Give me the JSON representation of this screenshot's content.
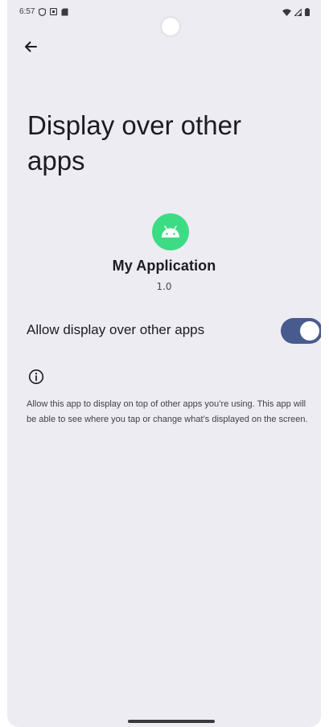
{
  "status_bar": {
    "time": "6:57",
    "icons_left": [
      "shield-icon",
      "media-icon",
      "sd-card-icon"
    ],
    "icons_right": [
      "wifi-icon",
      "signal-icon",
      "battery-icon"
    ]
  },
  "header": {
    "back_icon": "arrow-back-icon",
    "title": "Display over other apps"
  },
  "app": {
    "name": "My Application",
    "version": "1.0",
    "icon": "android-icon",
    "icon_color": "#3ddc84"
  },
  "setting": {
    "label": "Allow display over other apps",
    "enabled": true,
    "switch_color": "#485b8f"
  },
  "info": {
    "icon": "info-icon",
    "text": "Allow this app to display on top of other apps you’re using. This app will be able to see where you tap or change what’s displayed on the screen."
  }
}
